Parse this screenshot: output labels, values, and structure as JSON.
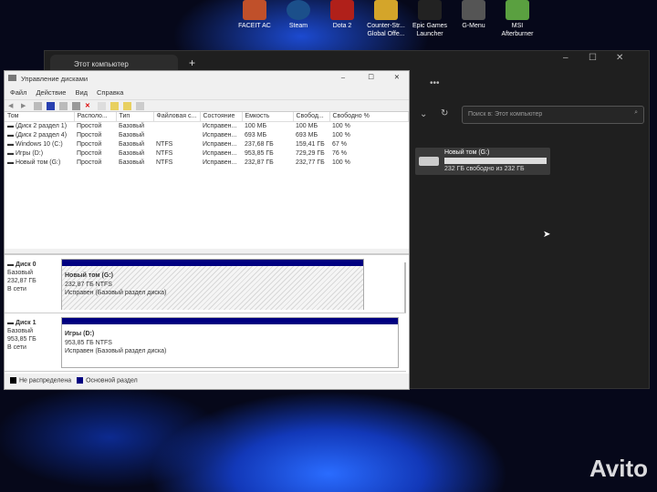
{
  "desktop_icons": [
    {
      "label": "FACEIT AC",
      "color": "#c0502a"
    },
    {
      "label": "Steam",
      "color": "#1b4f8a"
    },
    {
      "label": "Dota 2",
      "color": "#b0201a"
    },
    {
      "label": "Counter-Str... Global Offe...",
      "color": "#d4a52a"
    },
    {
      "label": "Epic Games Launcher",
      "color": "#222222"
    },
    {
      "label": "G-Menu",
      "color": "#555555"
    },
    {
      "label": "MSI Afterburner",
      "color": "#5aa040"
    }
  ],
  "explorer": {
    "tab_title": "Этот компьютер",
    "new_tab": "+",
    "more": "•••",
    "search_placeholder": "Поиск в: Этот компьютер",
    "drive": {
      "name": "Новый том (G:)",
      "free_text": "232 ГБ свободно из 232 ГБ",
      "used_fraction": 0.0
    }
  },
  "disk_mgmt": {
    "title": "Управление дисками",
    "menu": [
      "Файл",
      "Действие",
      "Вид",
      "Справка"
    ],
    "columns": [
      "Том",
      "Располо...",
      "Тип",
      "Файловая с...",
      "Состояние",
      "Емкость",
      "Свобод...",
      "Свободно %"
    ],
    "rows": [
      [
        "(Диск 2 раздел 1)",
        "Простой",
        "Базовый",
        "",
        "Исправен...",
        "100 МБ",
        "100 МБ",
        "100 %"
      ],
      [
        "(Диск 2 раздел 4)",
        "Простой",
        "Базовый",
        "",
        "Исправен...",
        "693 МБ",
        "693 МБ",
        "100 %"
      ],
      [
        "Windows 10 (C:)",
        "Простой",
        "Базовый",
        "NTFS",
        "Исправен...",
        "237,68 ГБ",
        "159,41 ГБ",
        "67 %"
      ],
      [
        "Игры (D:)",
        "Простой",
        "Базовый",
        "NTFS",
        "Исправен...",
        "953,85 ГБ",
        "729,29 ГБ",
        "76 %"
      ],
      [
        "Новый том (G:)",
        "Простой",
        "Базовый",
        "NTFS",
        "Исправен...",
        "232,87 ГБ",
        "232,77 ГБ",
        "100 %"
      ]
    ],
    "disks": [
      {
        "name": "Диск 0",
        "type": "Базовый",
        "size": "232,87 ГБ",
        "status": "В сети",
        "part_name": "Новый том  (G:)",
        "part_size": "232,87 ГБ NTFS",
        "part_status": "Исправен (Базовый раздел диска)"
      },
      {
        "name": "Диск 1",
        "type": "Базовый",
        "size": "953,85 ГБ",
        "status": "В сети",
        "part_name": "Игры  (D:)",
        "part_size": "953,85 ГБ NTFS",
        "part_status": "Исправен (Базовый раздел диска)"
      }
    ],
    "legend": [
      {
        "label": "Не распределена",
        "color": "#000000"
      },
      {
        "label": "Основной раздел",
        "color": "#000080"
      }
    ]
  },
  "watermark": "Avito"
}
